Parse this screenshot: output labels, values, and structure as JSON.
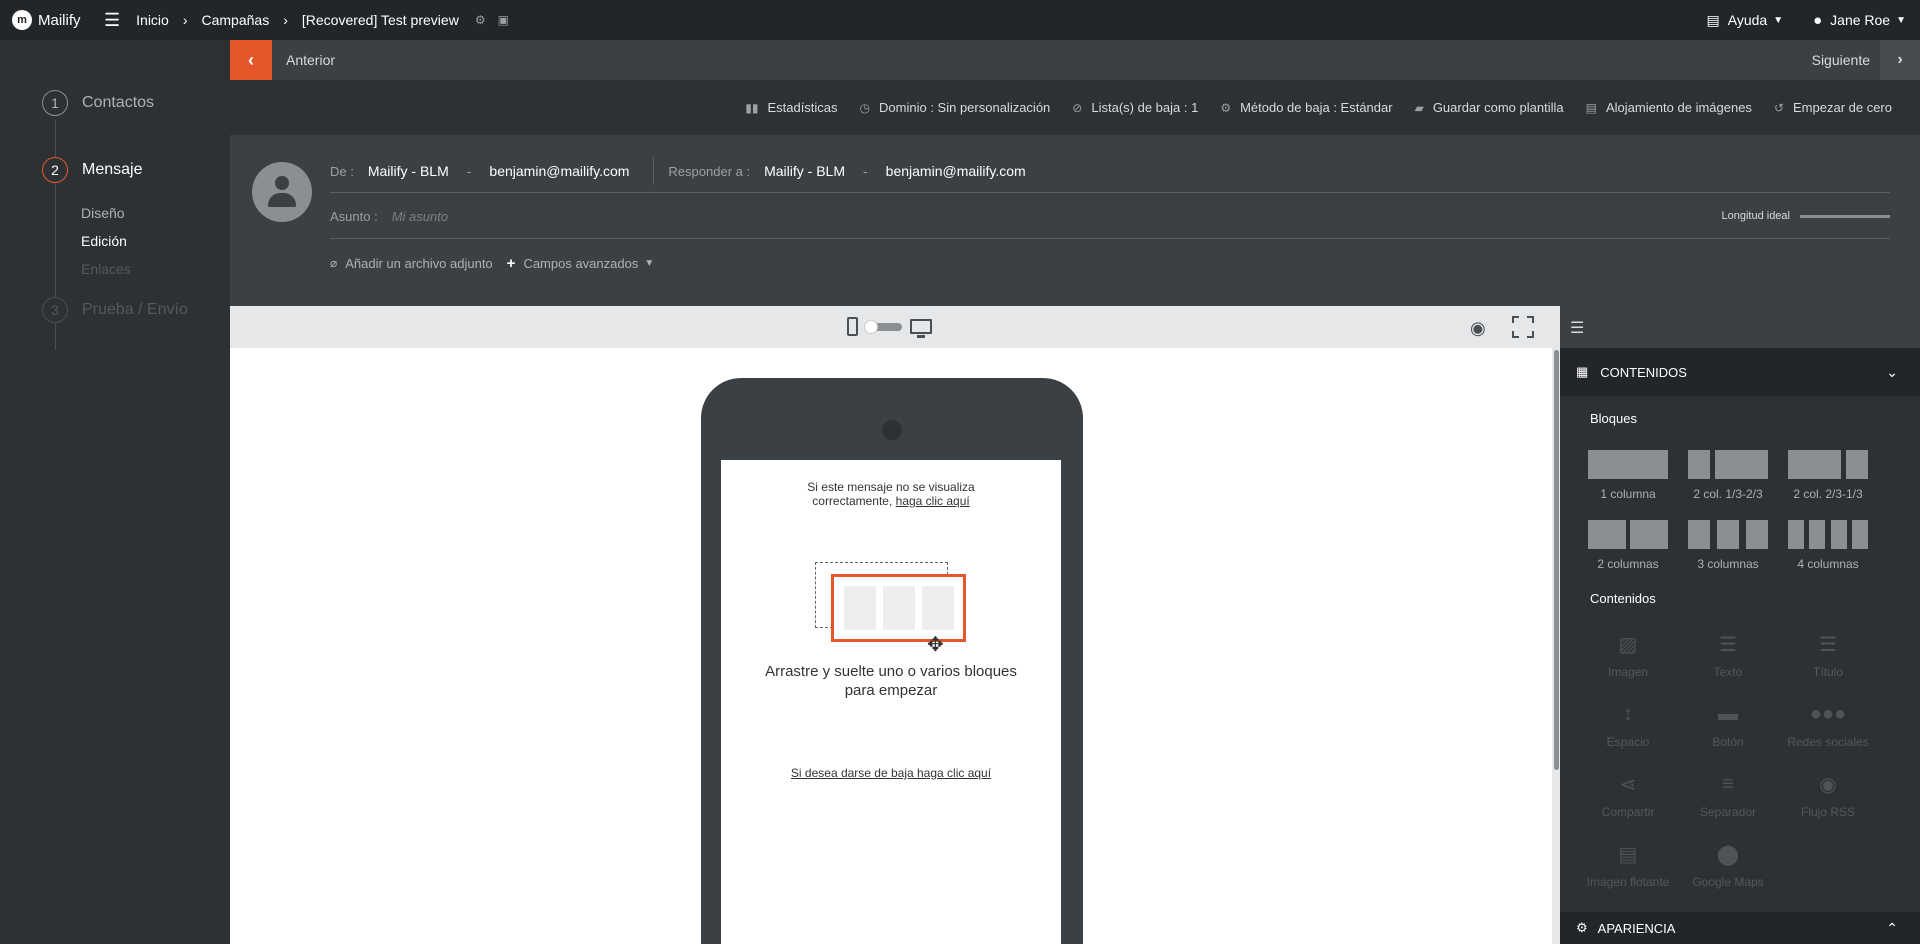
{
  "app": {
    "name": "Mailify",
    "logo_glyph": "m"
  },
  "breadcrumb": {
    "home": "Inicio",
    "campaigns": "Campañas",
    "current": "[Recovered] Test preview"
  },
  "topbar": {
    "help": "Ayuda",
    "user": "Jane Roe"
  },
  "steps": [
    {
      "num": "1",
      "label": "Contactos"
    },
    {
      "num": "2",
      "label": "Mensaje"
    },
    {
      "num": "3",
      "label": "Prueba / Envío"
    }
  ],
  "substeps": {
    "design": "Diseño",
    "edit": "Edición",
    "links": "Enlaces"
  },
  "nav": {
    "prev": "Anterior",
    "next": "Siguiente"
  },
  "toolbar": {
    "stats": "Estadísticas",
    "domain": "Dominio : Sin personalización",
    "unsub_lists": "Lista(s) de baja : 1",
    "unsub_method": "Método de baja : Estándar",
    "save_template": "Guardar como plantilla",
    "image_hosting": "Alojamiento de imágenes",
    "start_over": "Empezar de cero"
  },
  "header": {
    "from_label": "De :",
    "from_name": "Mailify - BLM",
    "from_email": "benjamin@mailify.com",
    "reply_label": "Responder a :",
    "reply_name": "Mailify - BLM",
    "reply_email": "benjamin@mailify.com",
    "dash": "-",
    "subject_label": "Asunto :",
    "subject_placeholder": "Mi asunto",
    "ideal_length": "Longitud ideal",
    "attach": "Añadir un archivo adjunto",
    "advanced": "Campos avanzados"
  },
  "email": {
    "top_line1": "Si este mensaje no se visualiza",
    "top_line2": "correctamente,",
    "top_link": "haga clic aquí",
    "drop_line1": "Arrastre y suelte uno o varios bloques",
    "drop_line2": "para empezar",
    "unsubscribe": "Si desea darse de baja haga clic aquí"
  },
  "panel": {
    "contents_title": "CONTENIDOS",
    "blocks_title": "Bloques",
    "blocks": [
      {
        "label": "1 columna"
      },
      {
        "label": "2 col. 1/3-2/3"
      },
      {
        "label": "2 col. 2/3-1/3"
      },
      {
        "label": "2 columnas"
      },
      {
        "label": "3 columnas"
      },
      {
        "label": "4 columnas"
      }
    ],
    "contents_section": "Contenidos",
    "contents": [
      {
        "label": "Imagen",
        "icon": "image-icon"
      },
      {
        "label": "Texto",
        "icon": "text-icon"
      },
      {
        "label": "Título",
        "icon": "title-icon"
      },
      {
        "label": "Espacio",
        "icon": "space-icon"
      },
      {
        "label": "Botón",
        "icon": "button-icon"
      },
      {
        "label": "Redes sociales",
        "icon": "social-icon"
      },
      {
        "label": "Compartir",
        "icon": "share-icon"
      },
      {
        "label": "Separador",
        "icon": "separator-icon"
      },
      {
        "label": "Flujo RSS",
        "icon": "rss-icon"
      },
      {
        "label": "Imagen flotante",
        "icon": "floating-image-icon"
      },
      {
        "label": "Google Maps",
        "icon": "map-pin-icon"
      }
    ],
    "appearance_title": "APARIENCIA"
  },
  "colors": {
    "accent": "#e5572b",
    "dark": "#22262a",
    "panel": "#3b4044"
  }
}
